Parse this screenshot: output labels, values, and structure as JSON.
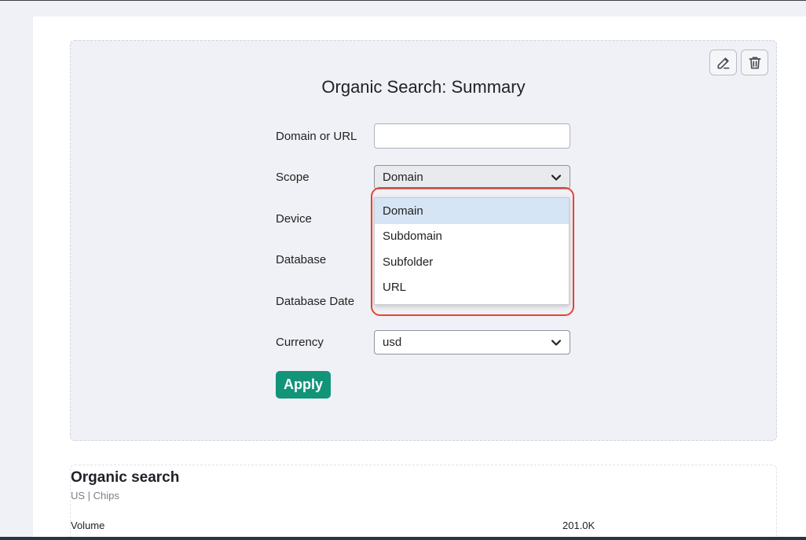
{
  "widget": {
    "title": "Organic Search: Summary",
    "edit_icon": "pencil-icon",
    "delete_icon": "trash-icon",
    "form": {
      "domain_label": "Domain or URL",
      "domain_value": "",
      "scope_label": "Scope",
      "scope_value": "Domain",
      "device_label": "Device",
      "database_label": "Database",
      "database_date_label": "Database Date",
      "currency_label": "Currency",
      "currency_value": "usd",
      "apply_label": "Apply"
    },
    "scope_dropdown": {
      "options": [
        "Domain",
        "Subdomain",
        "Subfolder",
        "URL"
      ],
      "selected_index": 0
    }
  },
  "results": {
    "title": "Organic search",
    "subtitle": "US | Chips",
    "metrics": [
      {
        "label": "Volume",
        "value": "201.0K"
      }
    ]
  },
  "colors": {
    "accent_green": "#129479",
    "highlight_red": "#e8432e",
    "option_selected": "#d6e5f6"
  }
}
